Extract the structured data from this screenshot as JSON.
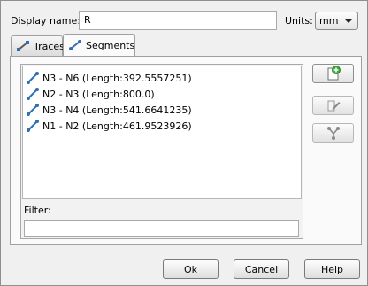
{
  "header": {
    "display_name_label": "Display name:",
    "display_name_value": "R",
    "units_label": "Units:",
    "units_value": "mm"
  },
  "tabs": [
    {
      "label": "Traces",
      "active": false
    },
    {
      "label": "Segments",
      "active": true
    }
  ],
  "segments": [
    {
      "label": "N3 - N6 (Length:392.5557251)"
    },
    {
      "label": "N2 - N3 (Length:800.0)"
    },
    {
      "label": "N3 - N4 (Length:541.6641235)"
    },
    {
      "label": "N1 - N2 (Length:461.9523926)"
    }
  ],
  "filter": {
    "label": "Filter:",
    "value": ""
  },
  "side_buttons": [
    {
      "icon": "add-segment-icon",
      "enabled": true
    },
    {
      "icon": "edit-segment-icon",
      "enabled": false
    },
    {
      "icon": "split-segment-icon",
      "enabled": false
    }
  ],
  "footer": {
    "ok_label": "Ok",
    "cancel_label": "Cancel",
    "help_label": "Help"
  },
  "colors": {
    "segment_icon": "#2f6fb0",
    "add_icon": "#3aa83a"
  }
}
